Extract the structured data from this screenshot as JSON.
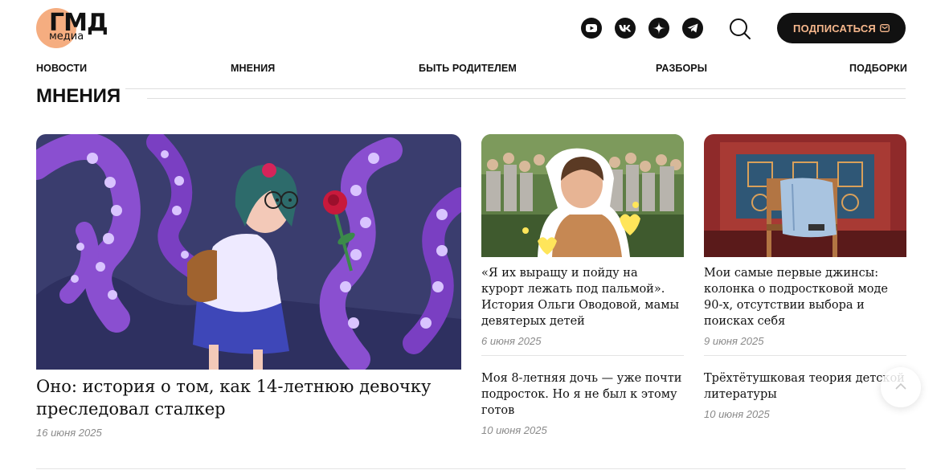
{
  "header": {
    "logo": {
      "main": "ГМД",
      "sub": "медиа"
    },
    "social": [
      {
        "name": "youtube-icon"
      },
      {
        "name": "vk-icon"
      },
      {
        "name": "dzen-icon"
      },
      {
        "name": "telegram-icon"
      }
    ],
    "subscribe_label": "ПОДПИСАТЬСЯ"
  },
  "nav": {
    "items": [
      {
        "label": "НОВОСТИ"
      },
      {
        "label": "МНЕНИЯ"
      },
      {
        "label": "БЫТЬ РОДИТЕЛЕМ"
      },
      {
        "label": "РАЗБОРЫ"
      },
      {
        "label": "ПОДБОРКИ"
      }
    ]
  },
  "section": {
    "title": "МНЕНИЯ"
  },
  "feature": {
    "title": "Оно: история о том, как 14-летнюю девочку преследовал сталкер",
    "date": "16 июня 2025"
  },
  "cards": [
    {
      "title": "«Я их выращу и пойду на курорт лежать под пальмой». История Ольги Оводовой, мамы девятерых детей",
      "date": "6 июня 2025"
    },
    {
      "title": "Мои самые первые джинсы: колонка о подростковой моде 90-х, отсутствии выбора и поисках себя",
      "date": "9 июня 2025"
    },
    {
      "title": "Моя 8-летняя дочь — уже почти подросток. Но я не был к этому готов",
      "date": "10 июня 2025"
    },
    {
      "title": "Трёхтётушковая теория детской литературы",
      "date": "10 июня 2025"
    }
  ],
  "colors": {
    "accent": "#f5ad80",
    "dark": "#111111",
    "date_gray": "#8a8a8a",
    "illustration_bg": "#3a3d6e",
    "tentacle": "#8a4fd0"
  }
}
